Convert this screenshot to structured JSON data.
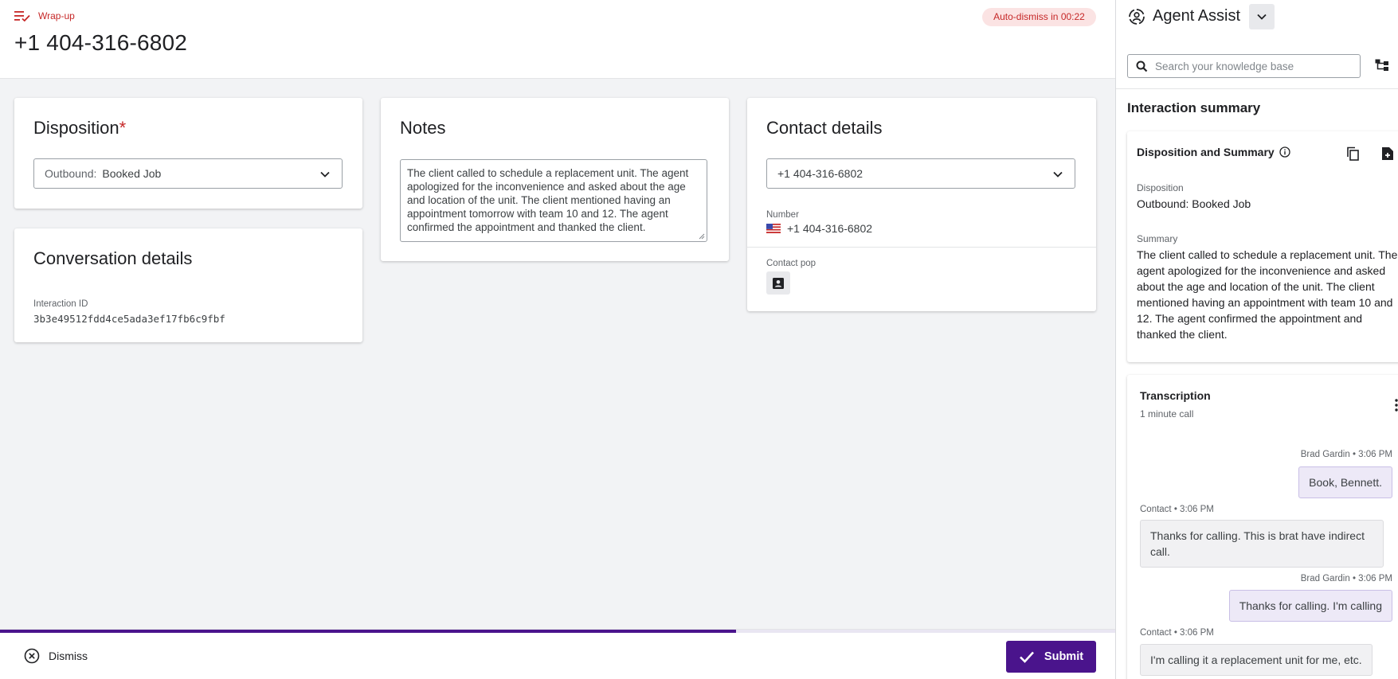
{
  "header": {
    "status_label": "Wrap-up",
    "phone_title": "+1 404-316-6802",
    "auto_dismiss": "Auto-dismiss in 00:22"
  },
  "disposition": {
    "title": "Disposition",
    "required_mark": "*",
    "select_prefix": "Outbound:",
    "select_value": "Booked Job"
  },
  "notes": {
    "title": "Notes",
    "text": "The client called to schedule a replacement unit. The agent apologized for the inconvenience and asked about the age and location of the unit. The client mentioned having an appointment tomorrow with team 10 and 12. The agent confirmed the appointment and thanked the client."
  },
  "contact_details": {
    "title": "Contact details",
    "select_value": "+1 404-316-6802",
    "number_label": "Number",
    "number_value": "+1 404-316-6802",
    "contact_pop_label": "Contact pop"
  },
  "conversation_details": {
    "title": "Conversation details",
    "interaction_id_label": "Interaction ID",
    "interaction_id": "3b3e49512fdd4ce5ada3ef17fb6c9fbf"
  },
  "footer": {
    "dismiss_label": "Dismiss",
    "submit_label": "Submit",
    "progress_fraction": 0.66
  },
  "agent_assist": {
    "title": "Agent Assist",
    "search_placeholder": "Search your knowledge base",
    "interaction_summary_title": "Interaction summary",
    "summary_card": {
      "title": "Disposition and Summary",
      "disposition_label": "Disposition",
      "disposition_value": "Outbound: Booked Job",
      "summary_label": "Summary",
      "summary_value": "The client called to schedule a replacement unit. The agent apologized for the inconvenience and asked about the age and location of the unit. The client mentioned having an appointment with team 10 and 12. The agent confirmed the appointment and thanked the client."
    },
    "transcription": {
      "title": "Transcription",
      "subtitle": "1 minute call",
      "messages": [
        {
          "meta": "Brad Gardin • 3:06 PM",
          "text": "Book, Bennett."
        },
        {
          "meta": "Contact • 3:06 PM",
          "text": "Thanks for calling. This is brat have indirect call."
        },
        {
          "meta": "Brad Gardin • 3:06 PM",
          "text": "Thanks for calling. I'm calling"
        },
        {
          "meta": "Contact • 3:06 PM",
          "text": "I'm calling it a replacement unit for me, etc."
        }
      ]
    }
  },
  "colors": {
    "accent": "#4a148c",
    "alert": "#c62828",
    "background": "#f2f3f5"
  }
}
